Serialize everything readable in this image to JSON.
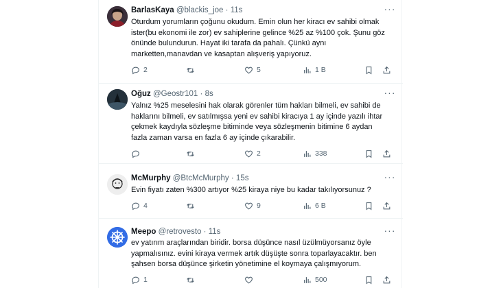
{
  "tweets": [
    {
      "name": "BarlasKaya",
      "handle": "@blackis_joe",
      "dot": "·",
      "time": "11s",
      "avatar": "avatar-photo",
      "lines": [
        "Oturdum yorumların çoğunu okudum. Emin olun her kiracı ev sahibi olmak",
        "ister(bu ekonomi ile zor) ev sahiplerine gelince %25 az %100 çok. Şunu göz",
        "önünde bulundurun. Hayat iki tarafa da pahalı. Çünkü aynı",
        "marketten,manavdan ve kasaptan alışveriş yapıyoruz."
      ],
      "replies": "2",
      "retweets": "",
      "likes": "5",
      "views": "1 B"
    },
    {
      "name": "Oğuz",
      "handle": "@Geostr101",
      "dot": "·",
      "time": "8s",
      "avatar": "avatar-photo",
      "lines": [
        "Yalnız %25 meselesini hak olarak görenler tüm hakları bilmeli, ev sahibi de",
        "haklarını bilmeli, ev satılmışsa yeni ev sahibi kiracıya 1 ay içinde yazılı ihtar",
        "çekmek kaydıyla sözleşme bitiminde veya sözleşmenin bitimine 6 aydan",
        "fazla zaman varsa en fazla 6 ay içinde çıkarabilir."
      ],
      "replies": "",
      "retweets": "",
      "likes": "2",
      "views": "338"
    },
    {
      "name": "McMurphy",
      "handle": "@BtcMcMurphy",
      "dot": "·",
      "time": "15s",
      "avatar": "avatar-drawing",
      "lines": [
        "Evin fiyatı zaten %300 artıyor %25 kiraya niye bu kadar takılıyorsunuz ?"
      ],
      "replies": "4",
      "retweets": "",
      "likes": "9",
      "views": "6 B"
    },
    {
      "name": "Meepo",
      "handle": "@retrovesto",
      "dot": "·",
      "time": "11s",
      "avatar": "helm-logo",
      "lines": [
        "ev yatırım araçlarından biridir. borsa düşünce nasıl üzülmüyorsanız öyle",
        "yapmalısınız. evini kiraya vermek artık düşüşte sonra toparlayacaktır. ben",
        "şahsen borsa düşünce şirketin yönetimine el koymaya çalışmıyorum."
      ],
      "replies": "1",
      "retweets": "",
      "likes": "",
      "views": "500"
    }
  ],
  "colors": {
    "text": "#0f1419",
    "muted": "#536471",
    "divider": "#eff3f4",
    "helm_blue": "#326ce5"
  },
  "icons": [
    "reply-icon",
    "retweet-icon",
    "like-icon",
    "views-icon",
    "bookmark-icon",
    "share-icon",
    "more-icon"
  ]
}
